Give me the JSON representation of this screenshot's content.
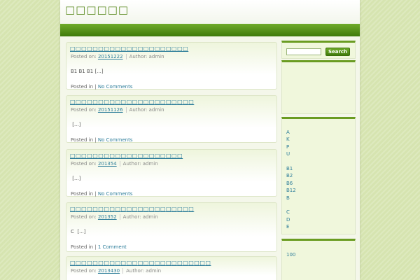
{
  "site": {
    "title": "□□□□□□"
  },
  "search": {
    "placeholder": "",
    "button_label": "Search"
  },
  "posts": [
    {
      "title": "□□□□□□□□□□□□□□□□□□□□□",
      "posted_on_label": "Posted on:",
      "date": "20151222",
      "author_label": "Author: admin",
      "excerpt": "B1 B1 B1 [...]",
      "posted_in_label": "Posted in  |",
      "comments": "No Comments"
    },
    {
      "title": "□□□□□□□□□□□□□□□□□□□□□□",
      "posted_on_label": "Posted on:",
      "date": "20151126",
      "author_label": "Author: admin",
      "excerpt": " [...]",
      "posted_in_label": "Posted in  |",
      "comments": "No Comments"
    },
    {
      "title": "□□□□□□□□□□□□□□□□□□□□",
      "posted_on_label": "Posted on:",
      "date": "201354",
      "author_label": "Author: admin",
      "excerpt": " [...]",
      "posted_in_label": "Posted in  |",
      "comments": "No Comments"
    },
    {
      "title": "□□□□□□□□□□□□□□□□□□□□□□",
      "posted_on_label": "Posted on:",
      "date": "201352",
      "author_label": "Author: admin",
      "excerpt": "C  [...]",
      "posted_in_label": "Posted in  |",
      "comments": "1 Comment"
    },
    {
      "title": "□□□□□□□□□□□□□□□□□□□□□□□□□",
      "posted_on_label": "Posted on:",
      "date": "2013430",
      "author_label": "Author: admin"
    }
  ],
  "sidebar": {
    "links": [
      "A",
      "K",
      "P",
      "U",
      "",
      "B1",
      "B2",
      "B6",
      "B12",
      "B",
      "",
      "C",
      "D",
      "E"
    ],
    "count_text": "100"
  },
  "colors": {
    "accent_green": "#5a8a1e",
    "nav_green": "#4c8a12",
    "link_blue": "#2d7d9a",
    "page_bg": "#d6e4b0"
  }
}
